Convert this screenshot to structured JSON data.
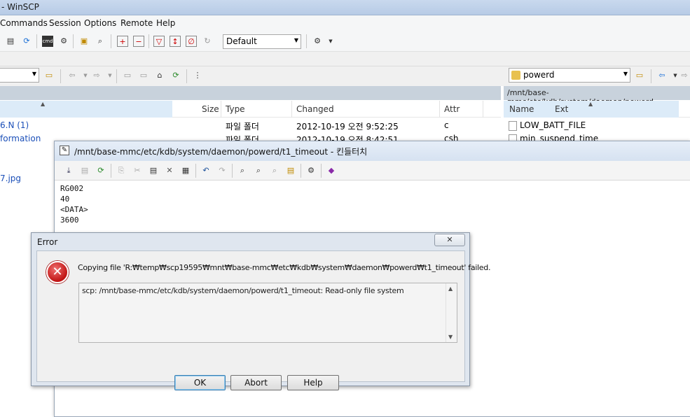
{
  "window": {
    "title": "- WinSCP"
  },
  "menu": [
    "Commands",
    "Session",
    "Options",
    "Remote",
    "Help"
  ],
  "toolbar": {
    "preset": "Default"
  },
  "right_panel": {
    "folder": "powerd",
    "path": "/mnt/base-mmc/etc/kdb/system/daemon/powerd",
    "col_name": "Name",
    "col_ext": "Ext",
    "files": [
      "LOW_BATT_FILE",
      "min_suspend_time"
    ]
  },
  "left_panel": {
    "columns": {
      "size": "Size",
      "type": "Type",
      "changed": "Changed",
      "attr": "Attr"
    },
    "rows": [
      {
        "name": "6.N (1)",
        "type": "파일 폴더",
        "changed": "2012-10-19  오전 9:52:25",
        "attr": "c"
      },
      {
        "name": "formation",
        "type": "파일 폴더",
        "changed": "2012-10-19  오전 8:42:51",
        "attr": "csh"
      },
      {
        "name": "7.jpg",
        "type": "",
        "changed": "",
        "attr": ""
      }
    ]
  },
  "editor": {
    "title": "/mnt/base-mmc/etc/kdb/system/daemon/powerd/t1_timeout - 킨들터치",
    "lines": [
      "RG002",
      "40",
      "<DATA>",
      "3600"
    ]
  },
  "dialog": {
    "title": "Error",
    "message": "Copying file 'R:₩temp₩scp19595₩mnt₩base-mmc₩etc₩kdb₩system₩daemon₩powerd₩t1_timeout' failed.",
    "detail": "scp: /mnt/base-mmc/etc/kdb/system/daemon/powerd/t1_timeout: Read-only file system",
    "buttons": {
      "ok": "OK",
      "abort": "Abort",
      "help": "Help"
    }
  }
}
